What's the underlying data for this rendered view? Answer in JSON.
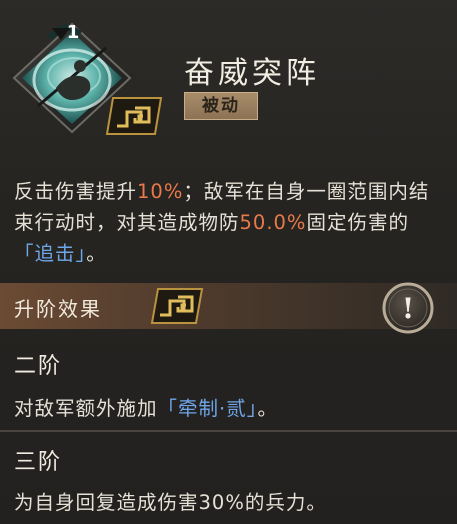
{
  "skill": {
    "level": "1",
    "name": "奋威突阵",
    "type": "被动"
  },
  "description": {
    "seg1": "反击伤害提升",
    "val1": "10%",
    "seg2": "；敌军在自身一圈范围内结束行动时，对其造成物防",
    "val2": "50.0%",
    "seg3": "固定伤害的",
    "link1": "「追击」",
    "seg4": "。"
  },
  "upgrade": {
    "title": "升阶效果",
    "info_symbol": "!"
  },
  "stages": [
    {
      "title": "二阶",
      "text_prefix": "对敌军额外施加",
      "link": "「牵制·贰」",
      "text_suffix": "。"
    },
    {
      "title": "三阶",
      "text": "为自身回复造成伤害30%的兵力。"
    }
  ],
  "colors": {
    "highlight": "#e8794a",
    "link": "#6ea6e8",
    "tag_bg": "#a88c6a",
    "upgrade_bar": "#6b4b34"
  },
  "icons": {
    "skill_icon": "warrior-swirl-icon",
    "grade_emblem": "gold-meander-emblem-icon",
    "info_button": "exclamation-icon"
  }
}
